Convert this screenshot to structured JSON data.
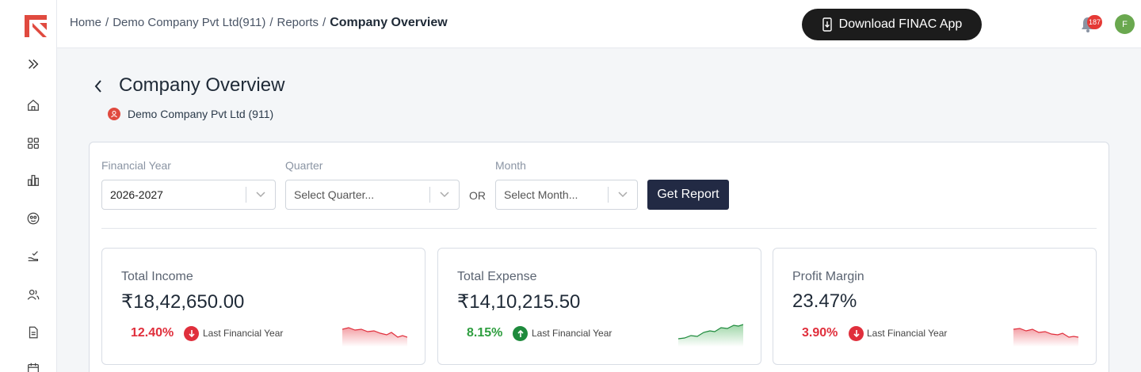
{
  "header": {
    "breadcrumb": [
      {
        "label": "Home"
      },
      {
        "label": "Demo Company Pvt Ltd(911)"
      },
      {
        "label": "Reports"
      }
    ],
    "current": "Company Overview",
    "separator": "/",
    "download_label": "Download FINAC App",
    "notifications_count": "187",
    "avatar_initial": "F"
  },
  "page": {
    "title": "Company Overview",
    "company": "Demo Company Pvt Ltd (911)"
  },
  "filters": {
    "financial_year_label": "Financial Year",
    "financial_year_value": "2026-2027",
    "quarter_label": "Quarter",
    "quarter_placeholder": "Select Quarter...",
    "or_label": "OR",
    "month_label": "Month",
    "month_placeholder": "Select Month...",
    "get_report_label": "Get Report"
  },
  "stats": [
    {
      "title": "Total Income",
      "value": "₹18,42,650.00",
      "change": "12.40%",
      "direction": "down",
      "compare": "Last Financial Year",
      "color": "#e02f3c"
    },
    {
      "title": "Total Expense",
      "value": "₹14,10,215.50",
      "change": "8.15%",
      "direction": "up",
      "compare": "Last Financial Year",
      "color": "#2e9e3f"
    },
    {
      "title": "Profit Margin",
      "value": "23.47%",
      "change": "3.90%",
      "direction": "down",
      "compare": "Last Financial Year",
      "color": "#e02f3c"
    }
  ],
  "sidebar_icons": [
    "expand-icon",
    "home-icon",
    "grid-icon",
    "bar-chart-icon",
    "face-icon",
    "hand-check-icon",
    "users-icon",
    "document-icon",
    "calendar-icon"
  ],
  "colors": {
    "brand_red": "#e04a3f",
    "dark_button": "#222a44",
    "download_button": "#1c1c1c"
  }
}
